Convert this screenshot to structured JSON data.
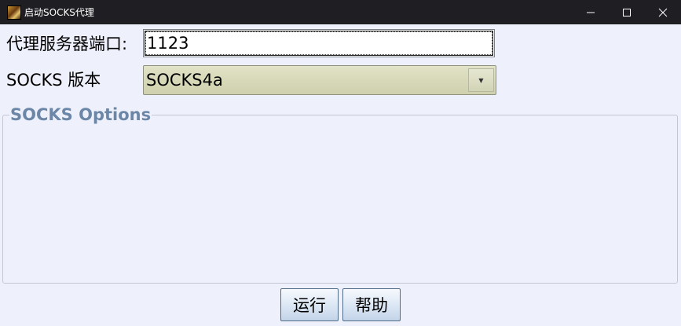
{
  "window": {
    "title": "启动SOCKS代理",
    "minimize_icon": "minimize-icon",
    "maximize_icon": "maximize-icon",
    "close_icon": "close-icon"
  },
  "form": {
    "port_label": "代理服务器端口:",
    "port_value": "1123",
    "version_label": "SOCKS 版本",
    "version_value": "SOCKS4a"
  },
  "options_group": {
    "legend": "SOCKS Options"
  },
  "buttons": {
    "run_label": "运行",
    "help_label": "帮助"
  }
}
